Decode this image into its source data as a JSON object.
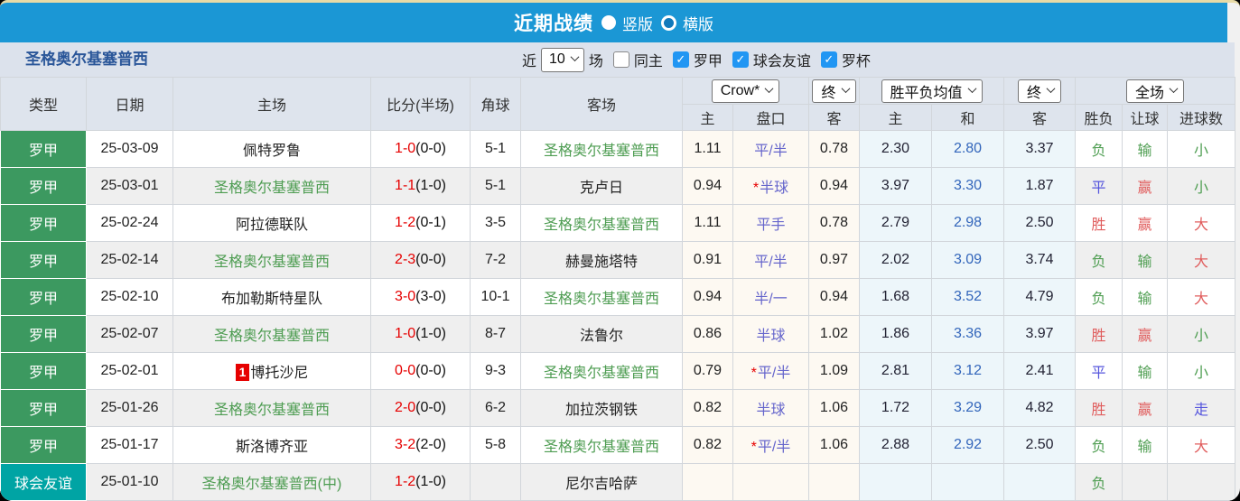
{
  "colors": {
    "bar_blue": "#1b97d5",
    "tan_line": "#e7daa6",
    "check_blue": "#2196f3",
    "type_green": "#3c9960",
    "type_teal": "#00a4a4",
    "team_green": "#4d9c51",
    "score_red": "#e60000",
    "handicap_blue": "#6666cc",
    "avg_blue": "#3366bb",
    "win_red": "#e05c5c",
    "draw_blue": "#5555dd",
    "lose_green": "#4f9e52"
  },
  "title_bar": {
    "title": "近期战绩",
    "vertical_label": "竖版",
    "horizontal_label": "横版"
  },
  "filter_bar": {
    "team": "圣格奥尔基塞普西",
    "near": "近",
    "count": "10",
    "games": "场",
    "same_home": "同主",
    "league1": "罗甲",
    "league2": "球会友谊",
    "league3": "罗杯"
  },
  "table": {
    "group_selects": {
      "company": "Crow*",
      "final1": "终",
      "avg": "胜平负均值",
      "final2": "终",
      "fulltime": "全场"
    },
    "columns": {
      "type": "类型",
      "date": "日期",
      "home": "主场",
      "score": "比分(半场)",
      "corner": "角球",
      "away": "客场",
      "h_home": "主",
      "h_handicap": "盘口",
      "h_away": "客",
      "a_home": "主",
      "a_draw": "和",
      "a_away": "客",
      "r_wdl": "胜负",
      "r_let": "让球",
      "r_goal": "进球数"
    },
    "rows": [
      {
        "type": "罗甲",
        "type_style": "green",
        "date": "25-03-09",
        "home_badge": "",
        "home": "佩特罗鲁",
        "home_green": false,
        "score_full": "1-0",
        "score_half": "(0-0)",
        "corner": "5-1",
        "away": "圣格奥尔基塞普西",
        "away_green": true,
        "odds_home": "1.11",
        "handicap_star": false,
        "handicap": "平/半",
        "odds_away": "0.78",
        "avg_home": "2.30",
        "avg_draw": "2.80",
        "avg_away": "3.37",
        "wdl": "负",
        "wdl_color": "green",
        "let": "输",
        "let_color": "green",
        "goal": "小",
        "goal_color": "green"
      },
      {
        "type": "罗甲",
        "type_style": "green",
        "date": "25-03-01",
        "home_badge": "",
        "home": "圣格奥尔基塞普西",
        "home_green": true,
        "score_full": "1-1",
        "score_half": "(1-0)",
        "corner": "5-1",
        "away": "克卢日",
        "away_green": false,
        "odds_home": "0.94",
        "handicap_star": true,
        "handicap": "半球",
        "odds_away": "0.94",
        "avg_home": "3.97",
        "avg_draw": "3.30",
        "avg_away": "1.87",
        "wdl": "平",
        "wdl_color": "blue",
        "let": "赢",
        "let_color": "red",
        "goal": "小",
        "goal_color": "green"
      },
      {
        "type": "罗甲",
        "type_style": "green",
        "date": "25-02-24",
        "home_badge": "",
        "home": "阿拉德联队",
        "home_green": false,
        "score_full": "1-2",
        "score_half": "(0-1)",
        "corner": "3-5",
        "away": "圣格奥尔基塞普西",
        "away_green": true,
        "odds_home": "1.11",
        "handicap_star": false,
        "handicap": "平手",
        "odds_away": "0.78",
        "avg_home": "2.79",
        "avg_draw": "2.98",
        "avg_away": "2.50",
        "wdl": "胜",
        "wdl_color": "red",
        "let": "赢",
        "let_color": "red",
        "goal": "大",
        "goal_color": "red"
      },
      {
        "type": "罗甲",
        "type_style": "green",
        "date": "25-02-14",
        "home_badge": "",
        "home": "圣格奥尔基塞普西",
        "home_green": true,
        "score_full": "2-3",
        "score_half": "(0-0)",
        "corner": "7-2",
        "away": "赫曼施塔特",
        "away_green": false,
        "odds_home": "0.91",
        "handicap_star": false,
        "handicap": "平/半",
        "odds_away": "0.97",
        "avg_home": "2.02",
        "avg_draw": "3.09",
        "avg_away": "3.74",
        "wdl": "负",
        "wdl_color": "green",
        "let": "输",
        "let_color": "green",
        "goal": "大",
        "goal_color": "red"
      },
      {
        "type": "罗甲",
        "type_style": "green",
        "date": "25-02-10",
        "home_badge": "",
        "home": "布加勒斯特星队",
        "home_green": false,
        "score_full": "3-0",
        "score_half": "(3-0)",
        "corner": "10-1",
        "away": "圣格奥尔基塞普西",
        "away_green": true,
        "odds_home": "0.94",
        "handicap_star": false,
        "handicap": "半/一",
        "odds_away": "0.94",
        "avg_home": "1.68",
        "avg_draw": "3.52",
        "avg_away": "4.79",
        "wdl": "负",
        "wdl_color": "green",
        "let": "输",
        "let_color": "green",
        "goal": "大",
        "goal_color": "red"
      },
      {
        "type": "罗甲",
        "type_style": "green",
        "date": "25-02-07",
        "home_badge": "",
        "home": "圣格奥尔基塞普西",
        "home_green": true,
        "score_full": "1-0",
        "score_half": "(1-0)",
        "corner": "8-7",
        "away": "法鲁尔",
        "away_green": false,
        "odds_home": "0.86",
        "handicap_star": false,
        "handicap": "半球",
        "odds_away": "1.02",
        "avg_home": "1.86",
        "avg_draw": "3.36",
        "avg_away": "3.97",
        "wdl": "胜",
        "wdl_color": "red",
        "let": "赢",
        "let_color": "red",
        "goal": "小",
        "goal_color": "green"
      },
      {
        "type": "罗甲",
        "type_style": "green",
        "date": "25-02-01",
        "home_badge": "1",
        "home": "博托沙尼",
        "home_green": false,
        "score_full": "0-0",
        "score_half": "(0-0)",
        "corner": "9-3",
        "away": "圣格奥尔基塞普西",
        "away_green": true,
        "odds_home": "0.79",
        "handicap_star": true,
        "handicap": "平/半",
        "odds_away": "1.09",
        "avg_home": "2.81",
        "avg_draw": "3.12",
        "avg_away": "2.41",
        "wdl": "平",
        "wdl_color": "blue",
        "let": "输",
        "let_color": "green",
        "goal": "小",
        "goal_color": "green"
      },
      {
        "type": "罗甲",
        "type_style": "green",
        "date": "25-01-26",
        "home_badge": "",
        "home": "圣格奥尔基塞普西",
        "home_green": true,
        "score_full": "2-0",
        "score_half": "(0-0)",
        "corner": "6-2",
        "away": "加拉茨钢铁",
        "away_green": false,
        "odds_home": "0.82",
        "handicap_star": false,
        "handicap": "半球",
        "odds_away": "1.06",
        "avg_home": "1.72",
        "avg_draw": "3.29",
        "avg_away": "4.82",
        "wdl": "胜",
        "wdl_color": "red",
        "let": "赢",
        "let_color": "red",
        "goal": "走",
        "goal_color": "blue"
      },
      {
        "type": "罗甲",
        "type_style": "green",
        "date": "25-01-17",
        "home_badge": "",
        "home": "斯洛博齐亚",
        "home_green": false,
        "score_full": "3-2",
        "score_half": "(2-0)",
        "corner": "5-8",
        "away": "圣格奥尔基塞普西",
        "away_green": true,
        "odds_home": "0.82",
        "handicap_star": true,
        "handicap": "平/半",
        "odds_away": "1.06",
        "avg_home": "2.88",
        "avg_draw": "2.92",
        "avg_away": "2.50",
        "wdl": "负",
        "wdl_color": "green",
        "let": "输",
        "let_color": "green",
        "goal": "大",
        "goal_color": "red"
      },
      {
        "type": "球会友谊",
        "type_style": "teal",
        "date": "25-01-10",
        "home_badge": "",
        "home": "圣格奥尔基塞普西(中)",
        "home_green": true,
        "score_full": "1-2",
        "score_half": "(1-0)",
        "corner": "",
        "away": "尼尔吉哈萨",
        "away_green": false,
        "odds_home": "",
        "handicap_star": false,
        "handicap": "",
        "odds_away": "",
        "avg_home": "",
        "avg_draw": "",
        "avg_away": "",
        "wdl": "负",
        "wdl_color": "green",
        "let": "",
        "let_color": "",
        "goal": "",
        "goal_color": ""
      }
    ]
  }
}
